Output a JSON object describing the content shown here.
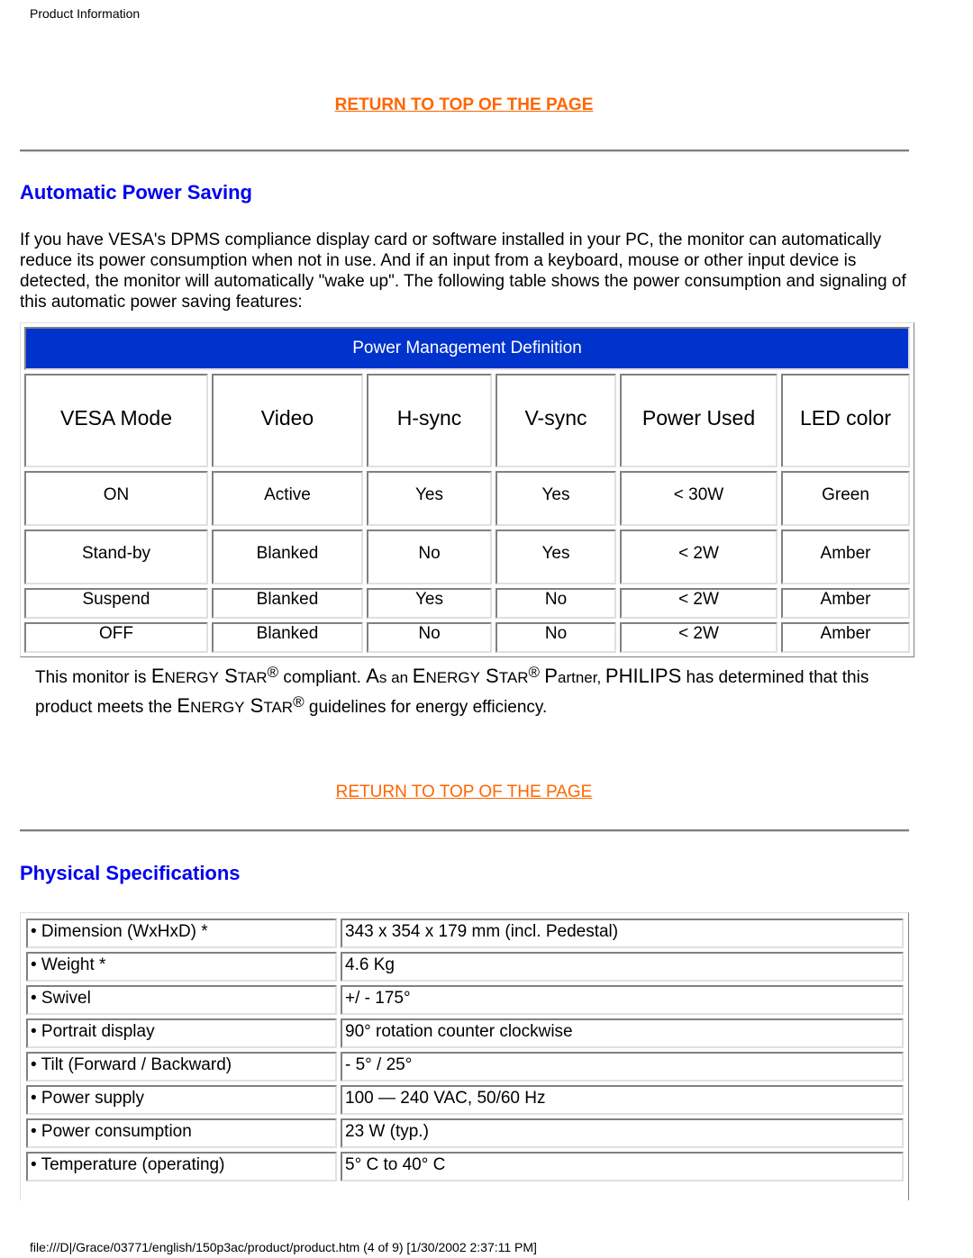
{
  "header": {
    "title": "Product Information"
  },
  "links": {
    "return_top_1": "RETURN TO TOP OF THE PAGE",
    "return_top_2": "RETURN TO TOP OF THE PAGE"
  },
  "power_saving": {
    "title": "Automatic Power Saving",
    "intro": "If you have VESA's DPMS compliance display card or software installed in your PC, the monitor can automatically reduce its power consumption when not in use. And if an input from a keyboard, mouse or other input device is detected, the monitor will automatically \"wake up\". The following table shows the power consumption and signaling of this automatic power saving features:",
    "table": {
      "caption": "Power Management Definition",
      "headers": [
        "VESA Mode",
        "Video",
        "H-sync",
        "V-sync",
        "Power Used",
        "LED color"
      ],
      "rows": [
        [
          "ON",
          "Active",
          "Yes",
          "Yes",
          "< 30W",
          "Green"
        ],
        [
          "Stand-by",
          "Blanked",
          "No",
          "Yes",
          "< 2W",
          "Amber"
        ],
        [
          "Suspend",
          "Blanked",
          "Yes",
          "No",
          "< 2W",
          "Amber"
        ],
        [
          "OFF",
          "Blanked",
          "No",
          "No",
          "< 2W",
          "Amber"
        ]
      ]
    },
    "energy_star": {
      "p1": "This monitor is ",
      "es_E": "E",
      "es_NERGY": "NERGY",
      "es_S": "S",
      "es_TAR": "TAR",
      "reg": "®",
      "p2": " compliant. ",
      "as_A": "A",
      "as_rest": "s an ",
      "p3": " ",
      "partner_P": "P",
      "partner_rest": "artner, ",
      "brand": "PHILIPS",
      "p4": " has determined that this product meets the ",
      "p5": " guidelines for energy efficiency."
    }
  },
  "physical": {
    "title": "Physical Specifications",
    "rows": [
      {
        "label": "• Dimension (WxHxD) *",
        "value": "343 x 354 x 179 mm (incl. Pedestal)"
      },
      {
        "label": "• Weight *",
        "value": "4.6 Kg"
      },
      {
        "label": "• Swivel",
        "value": "+/ - 175°"
      },
      {
        "label": "• Portrait display",
        "value": "90° rotation counter clockwise"
      },
      {
        "label": "• Tilt (Forward / Backward)",
        "value": "- 5° / 25°"
      },
      {
        "label": "• Power supply",
        "value": "100 — 240 VAC, 50/60 Hz"
      },
      {
        "label": "• Power consumption",
        "value": "23 W (typ.)"
      },
      {
        "label": "• Temperature (operating)",
        "value": "5° C to 40° C"
      }
    ]
  },
  "footer": {
    "text": "file:///D|/Grace/03771/english/150p3ac/product/product.htm (4 of 9) [1/30/2002 2:37:11 PM]"
  },
  "colors": {
    "link": "#ff6600",
    "heading": "#0000ee",
    "caption_bg": "#0033cc"
  }
}
